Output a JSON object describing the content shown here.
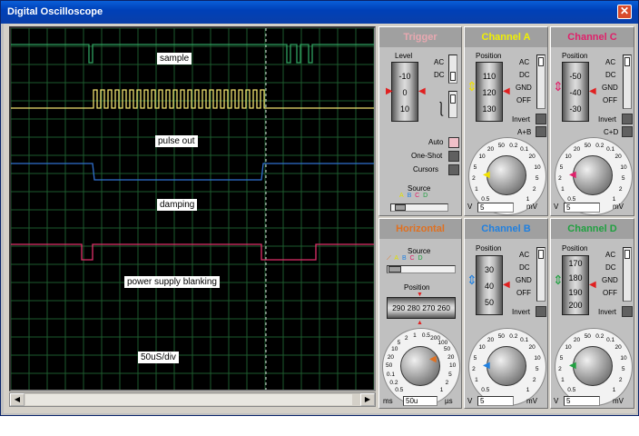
{
  "window": {
    "title": "Digital Oscilloscope",
    "close": "✕"
  },
  "screen": {
    "labels": {
      "sample": "sample",
      "pulse_out": "pulse out",
      "damping": "damping",
      "power_supply_blanking": "power supply blanking",
      "timebase": "50uS/div"
    },
    "trace_colors": {
      "sample": "#2fa060",
      "pulse_out": "#f0e070",
      "damping": "#3070d0",
      "blanking": "#e0306a"
    }
  },
  "trigger": {
    "title": "Trigger",
    "title_color": "#e8a8b0",
    "level_label": "Level",
    "level_ticks": [
      "-10",
      "0",
      "10"
    ],
    "ac": "AC",
    "dc": "DC",
    "auto": "Auto",
    "one_shot": "One-Shot",
    "cursors": "Cursors",
    "source_label": "Source",
    "sources": [
      "A",
      "B",
      "C",
      "D"
    ]
  },
  "channel_a": {
    "title": "Channel A",
    "title_color": "#f0f000",
    "position_label": "Position",
    "pos_ticks": [
      "110",
      "120",
      "130"
    ],
    "modes": [
      "AC",
      "DC",
      "GND",
      "OFF"
    ],
    "invert": "Invert",
    "combine": "A+B",
    "dial": [
      "0.2",
      "0.5",
      "1",
      "2",
      "5",
      "10",
      "20",
      "50",
      "0.1",
      "20",
      "10",
      "5",
      "2",
      "1"
    ],
    "unit_left": "V",
    "value": "5",
    "unit_right": "mV"
  },
  "channel_c": {
    "title": "Channel C",
    "title_color": "#e0206a",
    "position_label": "Position",
    "pos_ticks": [
      "-50",
      "-40",
      "-30"
    ],
    "modes": [
      "AC",
      "DC",
      "GND",
      "OFF"
    ],
    "invert": "Invert",
    "combine": "C+D",
    "unit_left": "V",
    "value": "5",
    "unit_right": "mV"
  },
  "horizontal": {
    "title": "Horizontal",
    "title_color": "#e07020",
    "source_label": "Source",
    "sources": [
      "A",
      "B",
      "C",
      "D"
    ],
    "position_label": "Position",
    "position_ticks": [
      "290",
      "280",
      "270",
      "260"
    ],
    "unit_left": "ms",
    "value": "50u",
    "unit_right": "µs"
  },
  "channel_b": {
    "title": "Channel B",
    "title_color": "#2080e0",
    "position_label": "Position",
    "pos_ticks": [
      "30",
      "40",
      "50"
    ],
    "modes": [
      "AC",
      "DC",
      "GND",
      "OFF"
    ],
    "invert": "Invert",
    "unit_left": "V",
    "value": "5",
    "unit_right": "mV"
  },
  "channel_d": {
    "title": "Channel D",
    "title_color": "#20a040",
    "position_label": "Position",
    "pos_ticks": [
      "170",
      "180",
      "190",
      "200"
    ],
    "modes": [
      "AC",
      "DC",
      "GND",
      "OFF"
    ],
    "invert": "Invert",
    "unit_left": "V",
    "value": "5",
    "unit_right": "mV"
  },
  "dial_scale": [
    "0.5",
    "1",
    "2",
    "5",
    "10",
    "20",
    "50",
    "0.2",
    "0.1",
    "20",
    "10",
    "5",
    "2",
    "1"
  ],
  "hdial_scale": [
    "0.5",
    "0.2",
    "0.1",
    "50",
    "20",
    "10",
    "5",
    "2",
    "1",
    "0.5",
    "200",
    "100",
    "50",
    "20",
    "10",
    "5",
    "2",
    "1"
  ]
}
